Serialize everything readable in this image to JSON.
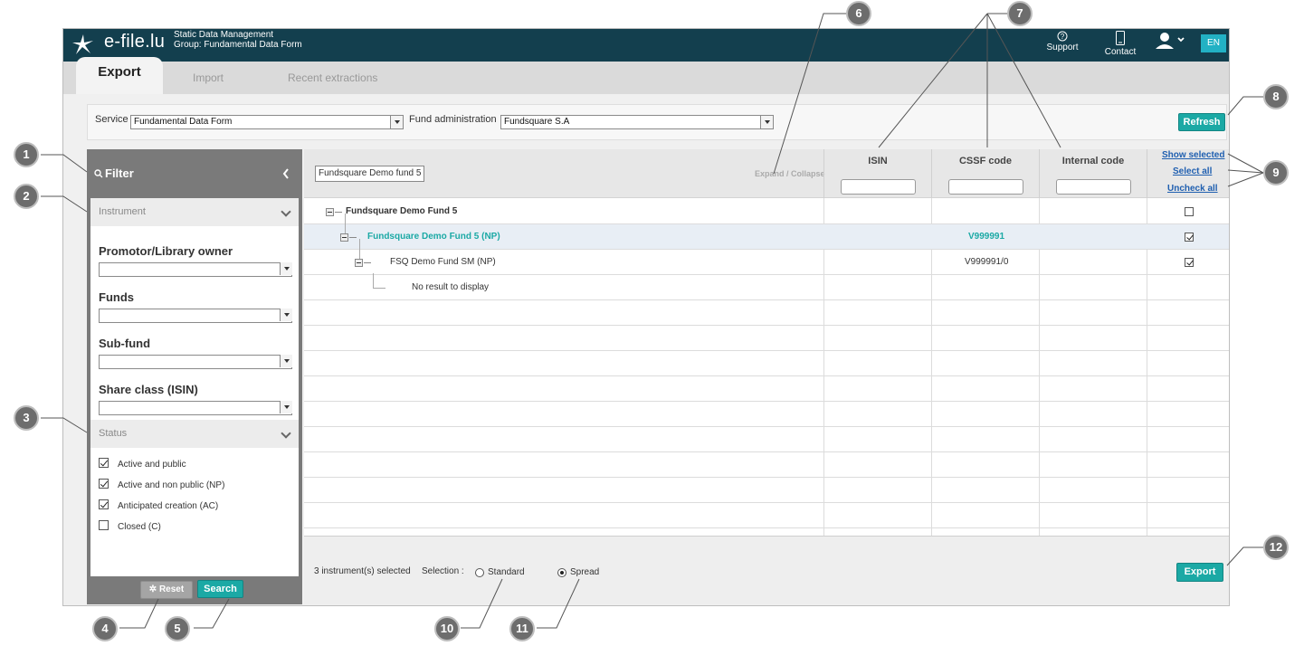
{
  "topbar": {
    "logo_text": "e-file.lu",
    "app_title": "Static Data Management",
    "group": "Group: Fundamental Data Form",
    "support_label": "Support",
    "contact_label": "Contact",
    "lang": "EN"
  },
  "tabs": [
    "Export",
    "Import",
    "Recent extractions"
  ],
  "service_bar": {
    "service_label": "Service",
    "service_value": "Fundamental Data Form",
    "fund_admin_label": "Fund administration",
    "fund_admin_value": "Fundsquare S.A",
    "refresh_label": "Refresh"
  },
  "filter": {
    "title": "Filter",
    "instrument_section": "Instrument",
    "promotor_label": "Promotor/Library owner",
    "funds_label": "Funds",
    "subfund_label": "Sub-fund",
    "shareclass_label": "Share class (ISIN)",
    "status_section": "Status",
    "statuses": [
      {
        "label": "Active and public",
        "checked": true
      },
      {
        "label": "Active and non public (NP)",
        "checked": true
      },
      {
        "label": "Anticipated creation (AC)",
        "checked": true
      },
      {
        "label": "Closed (C)",
        "checked": false
      }
    ],
    "reset_label": "Reset",
    "search_label": "Search"
  },
  "grid": {
    "search_tag": "Fundsquare Demo fund 5",
    "expand_collapse": "Expand / Collapse",
    "col_isin": "ISIN",
    "col_cssf": "CSSF code",
    "col_internal": "Internal code",
    "show_selected": "Show selected",
    "select_all": "Select all",
    "uncheck_all": "Uncheck all",
    "rows": [
      {
        "name": "Fundsquare Demo Fund 5",
        "cssf": "",
        "checked": false
      },
      {
        "name": "Fundsquare Demo Fund 5 (NP)",
        "cssf": "V999991",
        "checked": true
      },
      {
        "name": "FSQ Demo Fund SM (NP)",
        "cssf": "V999991/0",
        "checked": true
      },
      {
        "name": "No result to display",
        "cssf": ""
      }
    ]
  },
  "footer": {
    "selected_count": "3 instrument(s) selected",
    "selection_label": "Selection :",
    "standard_label": "Standard",
    "spread_label": "Spread",
    "export_label": "Export"
  },
  "callouts": [
    "1",
    "2",
    "3",
    "4",
    "5",
    "6",
    "7",
    "8",
    "9",
    "10",
    "11",
    "12"
  ],
  "colors": {
    "header": "#133f4e",
    "accent": "#1ba9a5",
    "highlight_text": "#1ba9a5"
  }
}
